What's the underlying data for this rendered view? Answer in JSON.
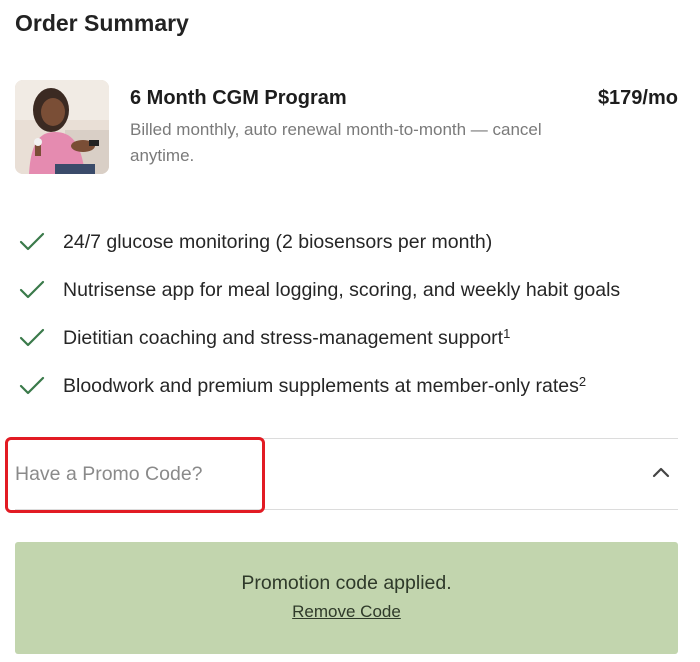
{
  "page_title": "Order Summary",
  "product": {
    "name": "6 Month CGM Program",
    "price": "$179/mo",
    "description": "Billed monthly, auto renewal month-to-month — cancel anytime."
  },
  "features": [
    {
      "text": "24/7 glucose monitoring (2 biosensors per month)",
      "note": ""
    },
    {
      "text": "Nutrisense app for meal logging, scoring, and weekly habit goals",
      "note": ""
    },
    {
      "text": "Dietitian coaching and stress-management support",
      "note": "1"
    },
    {
      "text": "Bloodwork and premium supplements at member-only rates",
      "note": "2"
    }
  ],
  "promo": {
    "label": "Have a Promo Code?",
    "applied_message": "Promotion code applied.",
    "remove_label": "Remove Code"
  },
  "colors": {
    "check": "#3a7a4a",
    "promo_applied_bg": "#c2d5ae",
    "highlight": "#e21b23"
  }
}
